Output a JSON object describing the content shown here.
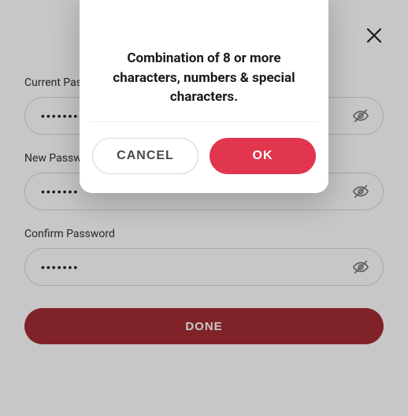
{
  "form": {
    "fields": {
      "current": {
        "label": "Current Password",
        "value": "•••••••••"
      },
      "new": {
        "label": "New Password",
        "value": "•••••••"
      },
      "confirm": {
        "label": "Confirm Password",
        "value": "•••••••"
      }
    },
    "done_label": "DONE"
  },
  "dialog": {
    "message": "Combination of 8 or more characters, numbers & special characters.",
    "cancel_label": "CANCEL",
    "ok_label": "OK"
  },
  "colors": {
    "accent": "#e1364e",
    "done": "#a52d35"
  }
}
